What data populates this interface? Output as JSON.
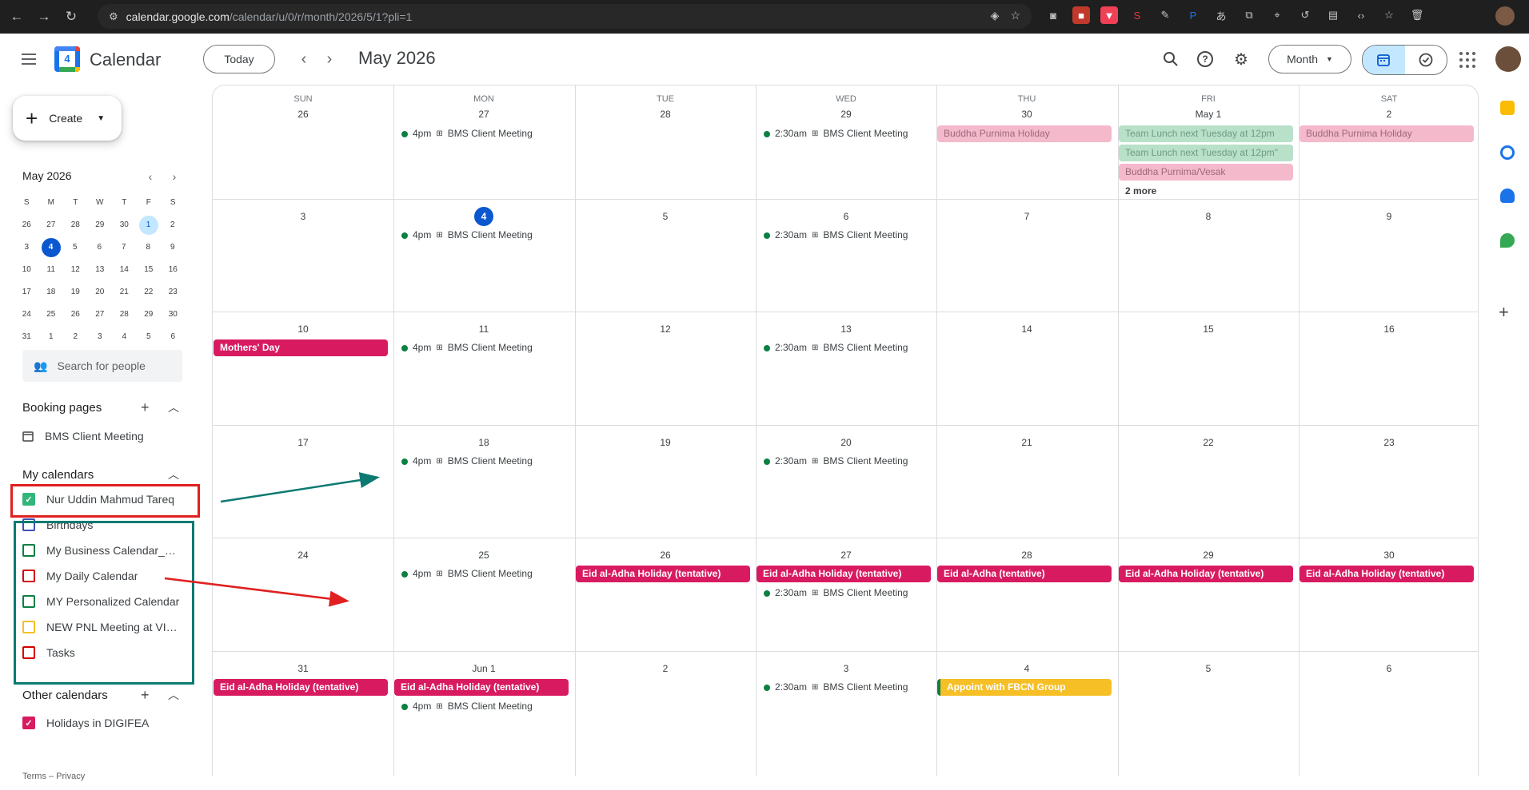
{
  "browser": {
    "url_main": "calendar.google.com",
    "url_path": "/calendar/u/0/r/month/2026/5/1?pli=1"
  },
  "header": {
    "app_name": "Calendar",
    "logo_day": "4",
    "today_label": "Today",
    "period_title": "May 2026",
    "view_label": "Month"
  },
  "sidebar": {
    "create_label": "Create",
    "mini": {
      "title": "May 2026",
      "dow": [
        "S",
        "M",
        "T",
        "W",
        "T",
        "F",
        "S"
      ],
      "weeks": [
        [
          "26",
          "27",
          "28",
          "29",
          "30",
          "1",
          "2"
        ],
        [
          "3",
          "4",
          "5",
          "6",
          "7",
          "8",
          "9"
        ],
        [
          "10",
          "11",
          "12",
          "13",
          "14",
          "15",
          "16"
        ],
        [
          "17",
          "18",
          "19",
          "20",
          "21",
          "22",
          "23"
        ],
        [
          "24",
          "25",
          "26",
          "27",
          "28",
          "29",
          "30"
        ],
        [
          "31",
          "1",
          "2",
          "3",
          "4",
          "5",
          "6"
        ]
      ]
    },
    "people_search_placeholder": "Search for people",
    "booking_title": "Booking pages",
    "booking_item": "BMS Client Meeting",
    "my_calendars_title": "My calendars",
    "my_calendars": [
      {
        "label": "Nur Uddin Mahmud Tareq",
        "color": "#33b679",
        "checked": true
      },
      {
        "label": "Birthdays",
        "color": "#3f51b5",
        "checked": false
      },
      {
        "label": "My Business Calendar_SE...",
        "color": "#0b8043",
        "checked": false
      },
      {
        "label": "My Daily Calendar",
        "color": "#d50000",
        "checked": false
      },
      {
        "label": "MY Personalized Calendar",
        "color": "#0b8043",
        "checked": false
      },
      {
        "label": "NEW PNL Meeting at VIP ...",
        "color": "#f6bf26",
        "checked": false
      },
      {
        "label": "Tasks",
        "color": "#d50000",
        "checked": false
      }
    ],
    "other_calendars_title": "Other calendars",
    "other_calendars": [
      {
        "label": "Holidays in DIGIFEA",
        "color": "#d81b60",
        "checked": true
      }
    ],
    "footer": "Terms – Privacy"
  },
  "month": {
    "dow": [
      "SUN",
      "MON",
      "TUE",
      "WED",
      "THU",
      "FRI",
      "SAT"
    ],
    "weeks": [
      [
        "26",
        "27",
        "28",
        "29",
        "30",
        "May 1",
        "2"
      ],
      [
        "3",
        "4",
        "5",
        "6",
        "7",
        "8",
        "9"
      ],
      [
        "10",
        "11",
        "12",
        "13",
        "14",
        "15",
        "16"
      ],
      [
        "17",
        "18",
        "19",
        "20",
        "21",
        "22",
        "23"
      ],
      [
        "24",
        "25",
        "26",
        "27",
        "28",
        "29",
        "30"
      ],
      [
        "31",
        "Jun 1",
        "2",
        "3",
        "4",
        "5",
        "6"
      ]
    ],
    "today_week": 1,
    "today_col": 1,
    "events": [
      {
        "w": 0,
        "c": 1,
        "slot": 0,
        "kind": "dot",
        "time": "4pm",
        "title": "BMS Client Meeting"
      },
      {
        "w": 0,
        "c": 3,
        "slot": 0,
        "kind": "dot",
        "time": "2:30am",
        "title": "BMS Client Meeting"
      },
      {
        "w": 0,
        "c": 4,
        "slot": 0,
        "kind": "dim-pink",
        "title": "Buddha Purnima Holiday"
      },
      {
        "w": 0,
        "c": 5,
        "slot": 0,
        "kind": "dim-green",
        "title": "Team Lunch next Tuesday at 12pm"
      },
      {
        "w": 0,
        "c": 5,
        "slot": 1,
        "kind": "dim-green",
        "title": "Team Lunch next Tuesday at 12pm\""
      },
      {
        "w": 0,
        "c": 5,
        "slot": 2,
        "kind": "dim-pink",
        "title": "Buddha Purnima/Vesak"
      },
      {
        "w": 0,
        "c": 5,
        "slot": 3,
        "kind": "more",
        "title": "2 more"
      },
      {
        "w": 0,
        "c": 6,
        "slot": 0,
        "kind": "dim-pink",
        "title": "Buddha Purnima Holiday"
      },
      {
        "w": 1,
        "c": 1,
        "slot": 0,
        "kind": "dot",
        "time": "4pm",
        "title": "BMS Client Meeting"
      },
      {
        "w": 1,
        "c": 3,
        "slot": 0,
        "kind": "dot",
        "time": "2:30am",
        "title": "BMS Client Meeting"
      },
      {
        "w": 2,
        "c": 0,
        "slot": 0,
        "kind": "pink",
        "title": "Mothers' Day"
      },
      {
        "w": 2,
        "c": 1,
        "slot": 0,
        "kind": "dot",
        "time": "4pm",
        "title": "BMS Client Meeting"
      },
      {
        "w": 2,
        "c": 3,
        "slot": 0,
        "kind": "dot",
        "time": "2:30am",
        "title": "BMS Client Meeting"
      },
      {
        "w": 3,
        "c": 1,
        "slot": 0,
        "kind": "dot",
        "time": "4pm",
        "title": "BMS Client Meeting"
      },
      {
        "w": 3,
        "c": 3,
        "slot": 0,
        "kind": "dot",
        "time": "2:30am",
        "title": "BMS Client Meeting"
      },
      {
        "w": 4,
        "c": 1,
        "slot": 0,
        "kind": "dot",
        "time": "4pm",
        "title": "BMS Client Meeting"
      },
      {
        "w": 4,
        "c": 2,
        "slot": 0,
        "kind": "pink",
        "title": "Eid al-Adha Holiday (tentative)"
      },
      {
        "w": 4,
        "c": 3,
        "slot": 0,
        "kind": "pink",
        "title": "Eid al-Adha Holiday (tentative)"
      },
      {
        "w": 4,
        "c": 3,
        "slot": 1,
        "kind": "dot",
        "time": "2:30am",
        "title": "BMS Client Meeting"
      },
      {
        "w": 4,
        "c": 4,
        "slot": 0,
        "kind": "pink",
        "title": "Eid al-Adha (tentative)"
      },
      {
        "w": 4,
        "c": 5,
        "slot": 0,
        "kind": "pink",
        "title": "Eid al-Adha Holiday (tentative)"
      },
      {
        "w": 4,
        "c": 6,
        "slot": 0,
        "kind": "pink",
        "title": "Eid al-Adha Holiday (tentative)"
      },
      {
        "w": 5,
        "c": 0,
        "slot": 0,
        "kind": "pink",
        "title": "Eid al-Adha Holiday (tentative)"
      },
      {
        "w": 5,
        "c": 1,
        "slot": 0,
        "kind": "pink",
        "title": "Eid al-Adha Holiday (tentative)"
      },
      {
        "w": 5,
        "c": 1,
        "slot": 1,
        "kind": "dot",
        "time": "4pm",
        "title": "BMS Client Meeting"
      },
      {
        "w": 5,
        "c": 3,
        "slot": 0,
        "kind": "dot",
        "time": "2:30am",
        "title": "BMS Client Meeting"
      },
      {
        "w": 5,
        "c": 4,
        "slot": 0,
        "kind": "yellow",
        "title": "Appoint with FBCN Group"
      }
    ]
  },
  "colors": {
    "accent": "#0b57d0",
    "holiday_pink": "#d81b60",
    "annotation_red": "#e02020",
    "annotation_teal": "#0d7a72"
  }
}
